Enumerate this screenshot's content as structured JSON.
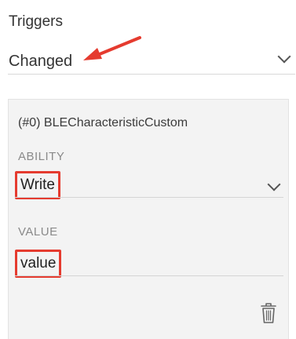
{
  "triggers": {
    "title": "Triggers",
    "selected": "Changed"
  },
  "card": {
    "title": "(#0) BLECharacteristicCustom",
    "ability": {
      "label": "ABILITY",
      "value": "Write"
    },
    "value_field": {
      "label": "VALUE",
      "value": "value"
    }
  },
  "icons": {
    "dropdown": "chevron-down-icon",
    "annotation": "arrow-icon",
    "delete": "trash-icon"
  },
  "colors": {
    "highlight": "#e53b2f",
    "card_background": "#f3f3f3",
    "text": "#333333",
    "label": "#8a8a8a"
  }
}
